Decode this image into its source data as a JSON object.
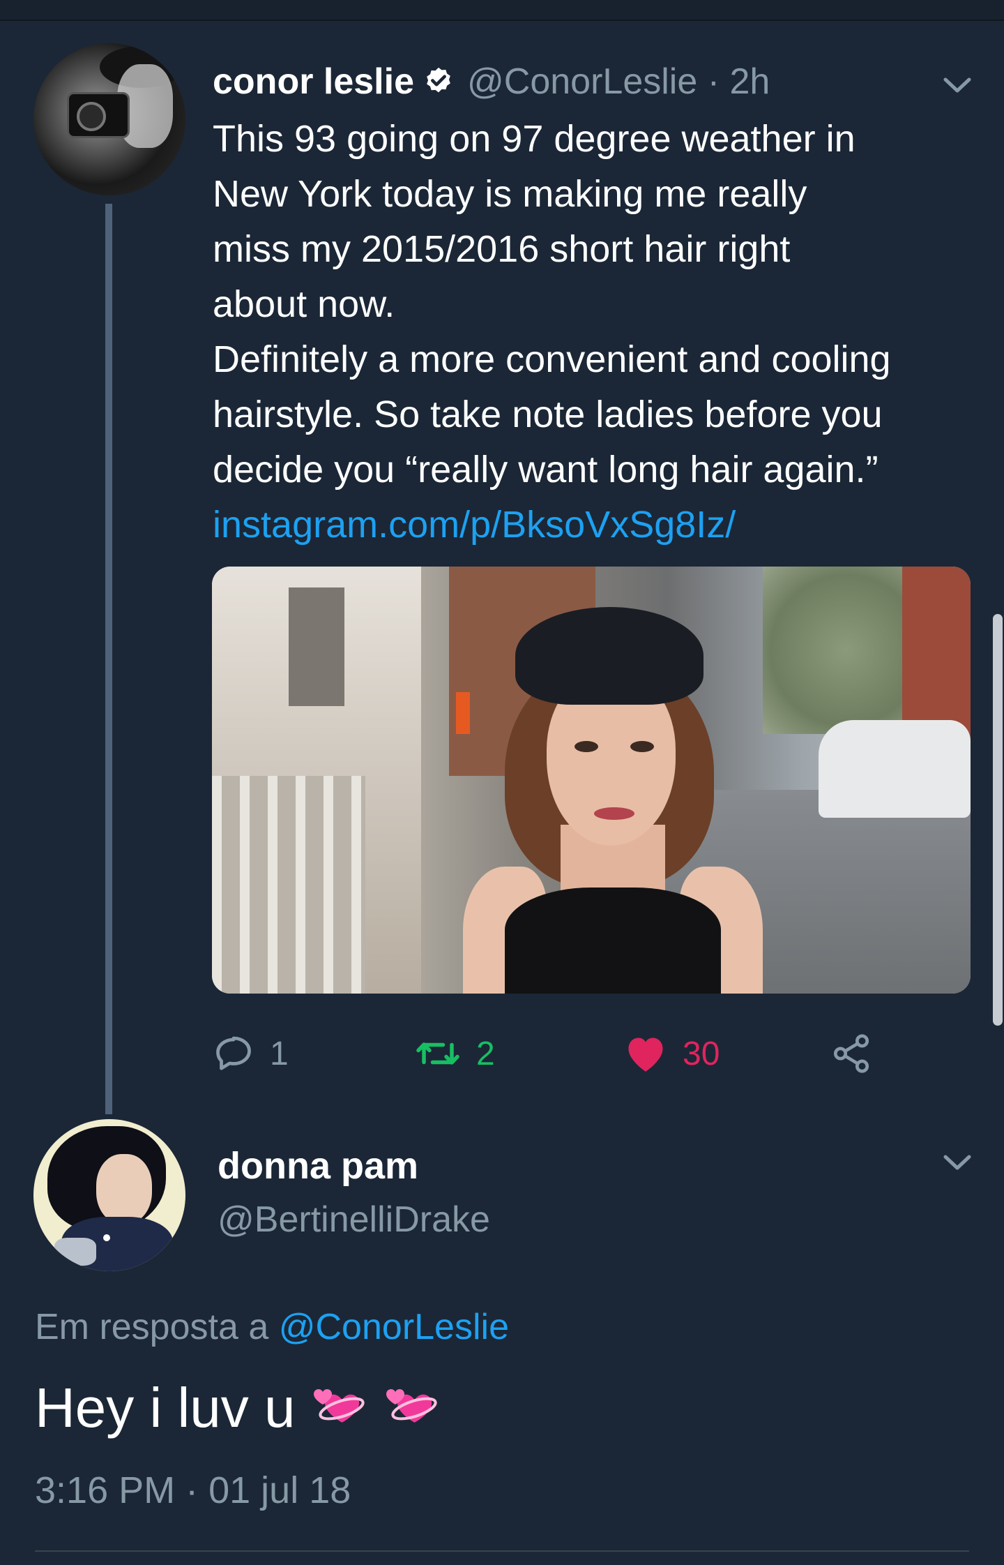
{
  "colors": {
    "background": "#1b2736",
    "secondary_text": "#8899a6",
    "link": "#1da1f2",
    "retweet": "#17bf63",
    "like": "#e0245e",
    "thread_line": "#4e6279"
  },
  "tweet": {
    "author_name": "conor leslie",
    "verified_icon": "verified-badge-icon",
    "handle_time": "@ConorLeslie · 2h",
    "lines": [
      "This 93 going on 97 degree weather in",
      "New York today is making me really",
      "miss my 2015/2016 short hair right",
      "about now.",
      "Definitely a more convenient and cooling",
      "hairstyle. So take note ladies before you",
      "decide you “really want long hair again.”"
    ],
    "link": "instagram.com/p/BksoVxSg8Iz/",
    "actions": {
      "reply_count": "1",
      "retweet_count": "2",
      "like_count": "30"
    }
  },
  "reply": {
    "author_name": "donna pam",
    "handle": "@BertinelliDrake",
    "reply_prefix": "Em resposta a ",
    "reply_to": "@ConorLeslie",
    "text": "Hey i luv u",
    "emoji": [
      "revolving-hearts-icon",
      "revolving-hearts-icon"
    ],
    "timestamp": "3:16 PM · 01 jul 18"
  }
}
